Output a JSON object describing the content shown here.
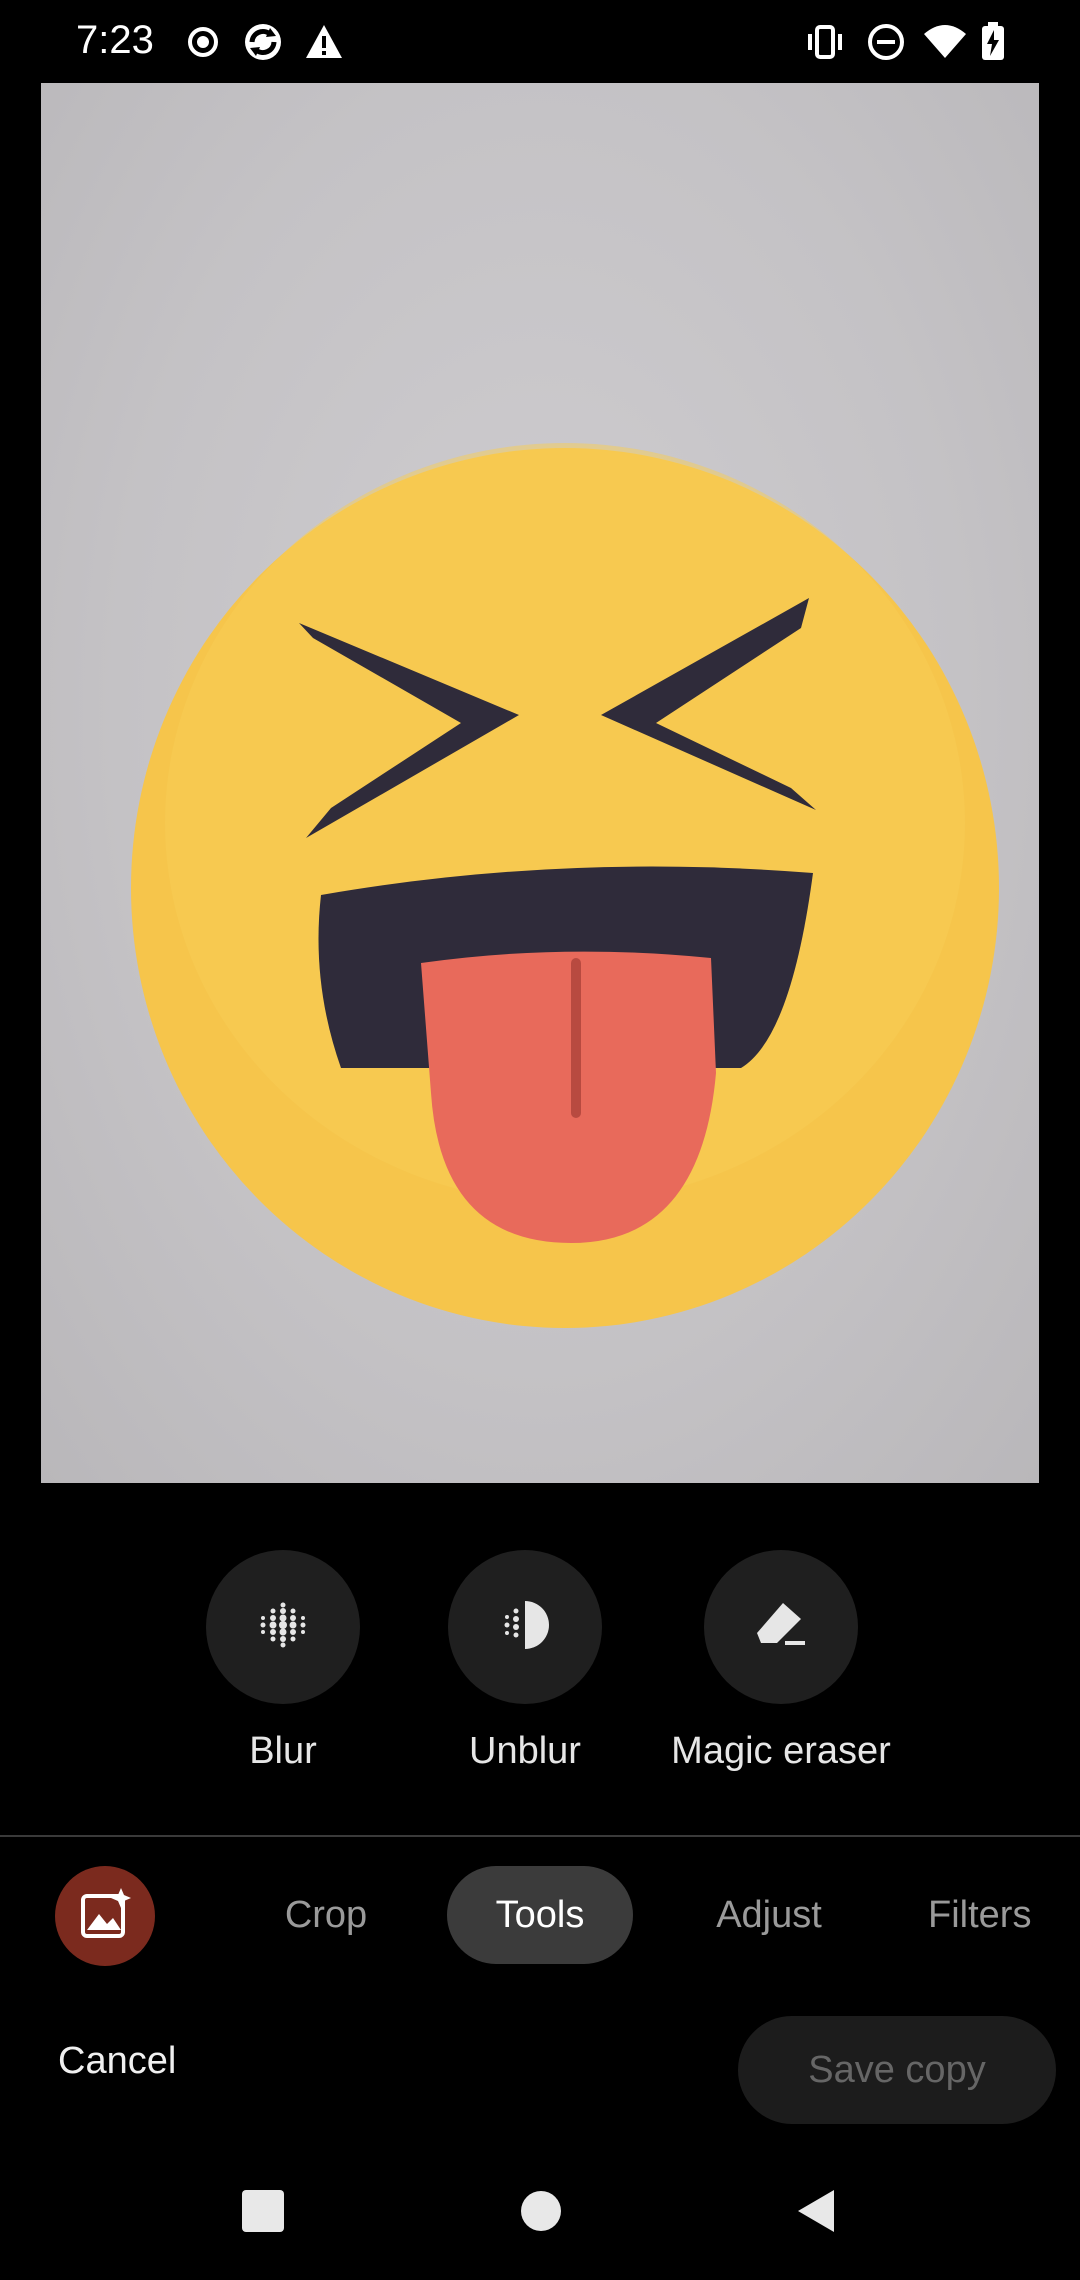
{
  "status_bar": {
    "time": "7:23",
    "left_icons": [
      "record-icon",
      "sync-icon",
      "warning-icon"
    ],
    "right_icons": [
      "vibrate-icon",
      "dnd-icon",
      "wifi-icon",
      "battery-charging-icon"
    ]
  },
  "photo": {
    "subject": "squinting-face-with-tongue-emoji",
    "colors": {
      "face": "#f6c54b",
      "features": "#2f2b3a",
      "tongue": "#e86a5b"
    }
  },
  "tools": [
    {
      "label": "Blur",
      "icon": "blur-icon"
    },
    {
      "label": "Unblur",
      "icon": "unblur-icon"
    },
    {
      "label": "Magic eraser",
      "icon": "eraser-icon"
    }
  ],
  "tabs": {
    "suggest_icon": "magic-photo-icon",
    "items": [
      {
        "label": "Crop",
        "active": false
      },
      {
        "label": "Tools",
        "active": true
      },
      {
        "label": "Adjust",
        "active": false
      },
      {
        "label": "Filters",
        "active": false
      }
    ]
  },
  "actions": {
    "cancel_label": "Cancel",
    "save_label": "Save copy"
  },
  "nav": [
    "recents-icon",
    "home-icon",
    "back-icon"
  ]
}
